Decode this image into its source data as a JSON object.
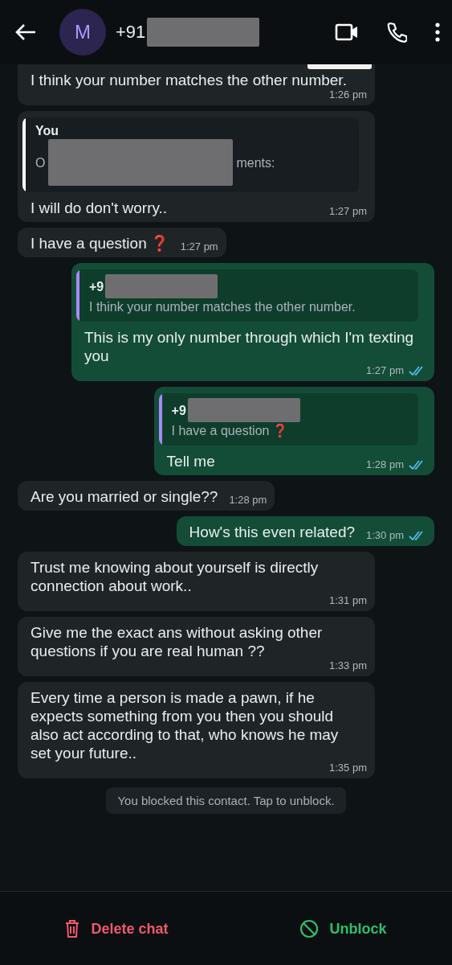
{
  "header": {
    "avatar_letter": "M",
    "contact": "+91",
    "contact_redacted": true
  },
  "messages": [
    {
      "kind": "incoming",
      "clipped_top": true,
      "text": "I think your number matches the other number.",
      "time": "1:26 pm"
    },
    {
      "kind": "incoming",
      "quote": {
        "author": "You",
        "text_left": "O",
        "text_right": "ments:",
        "redacted": true,
        "color": "#ffffff"
      },
      "text": "I will do don't worry..",
      "time": "1:27 pm"
    },
    {
      "kind": "incoming",
      "text": "I have a question",
      "emoji": "❓",
      "time": "1:27 pm"
    },
    {
      "kind": "outgoing",
      "quote": {
        "author": "+9",
        "text_left": "I think your number matches the other number.",
        "redacted": true,
        "color": "#a78bfa"
      },
      "text": "This is my only number through which I'm texting you",
      "time": "1:27 pm",
      "read": true
    },
    {
      "kind": "outgoing",
      "quote": {
        "author": "+9",
        "text_left": "I have a question",
        "emoji": "❓",
        "redacted": true,
        "color": "#a78bfa"
      },
      "text": "Tell me",
      "time": "1:28 pm",
      "read": true
    },
    {
      "kind": "incoming",
      "text": "Are you married or single??",
      "time": "1:28 pm"
    },
    {
      "kind": "outgoing",
      "text": "How's this even related?",
      "time": "1:30 pm",
      "read": true
    },
    {
      "kind": "incoming",
      "text": "Trust me knowing about yourself is directly connection about work..",
      "time": "1:31 pm"
    },
    {
      "kind": "incoming",
      "text": "Give me the exact ans without asking other questions if you are real human ??",
      "time": "1:33 pm"
    },
    {
      "kind": "incoming",
      "text": "Every time a person is made a pawn, if he expects something from you then you should also act according to that, who knows he may set your future..",
      "time": "1:35 pm"
    }
  ],
  "system_notice": "You blocked this contact. Tap to unblock.",
  "actions": [
    {
      "kind": "delete",
      "label": "Delete chat"
    },
    {
      "kind": "unblock",
      "label": "Unblock"
    }
  ]
}
